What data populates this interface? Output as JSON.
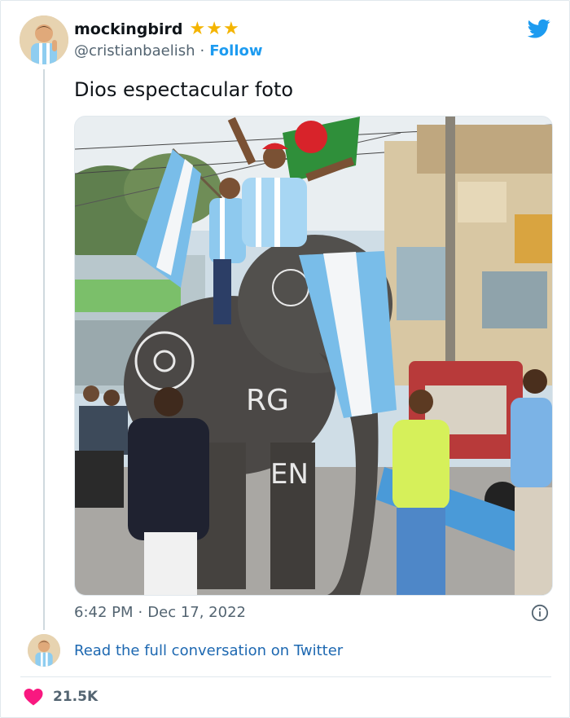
{
  "user": {
    "display_name": "mockingbird",
    "handle": "@cristianbaelish",
    "separator": "·",
    "follow_label": "Follow",
    "stars": [
      "★",
      "★",
      "★"
    ]
  },
  "tweet": {
    "text": "Dios espectacular foto",
    "time": "6:42 PM",
    "date_separator": "·",
    "date": "Dec 17, 2022"
  },
  "footer": {
    "read_more": "Read the full conversation on Twitter",
    "likes": "21.5K"
  },
  "colors": {
    "accent": "#1d9bf0",
    "like": "#f91880",
    "star": "#f4b400"
  },
  "icons": [
    "twitter-bird-icon",
    "info-icon",
    "heart-icon",
    "star-icon"
  ]
}
